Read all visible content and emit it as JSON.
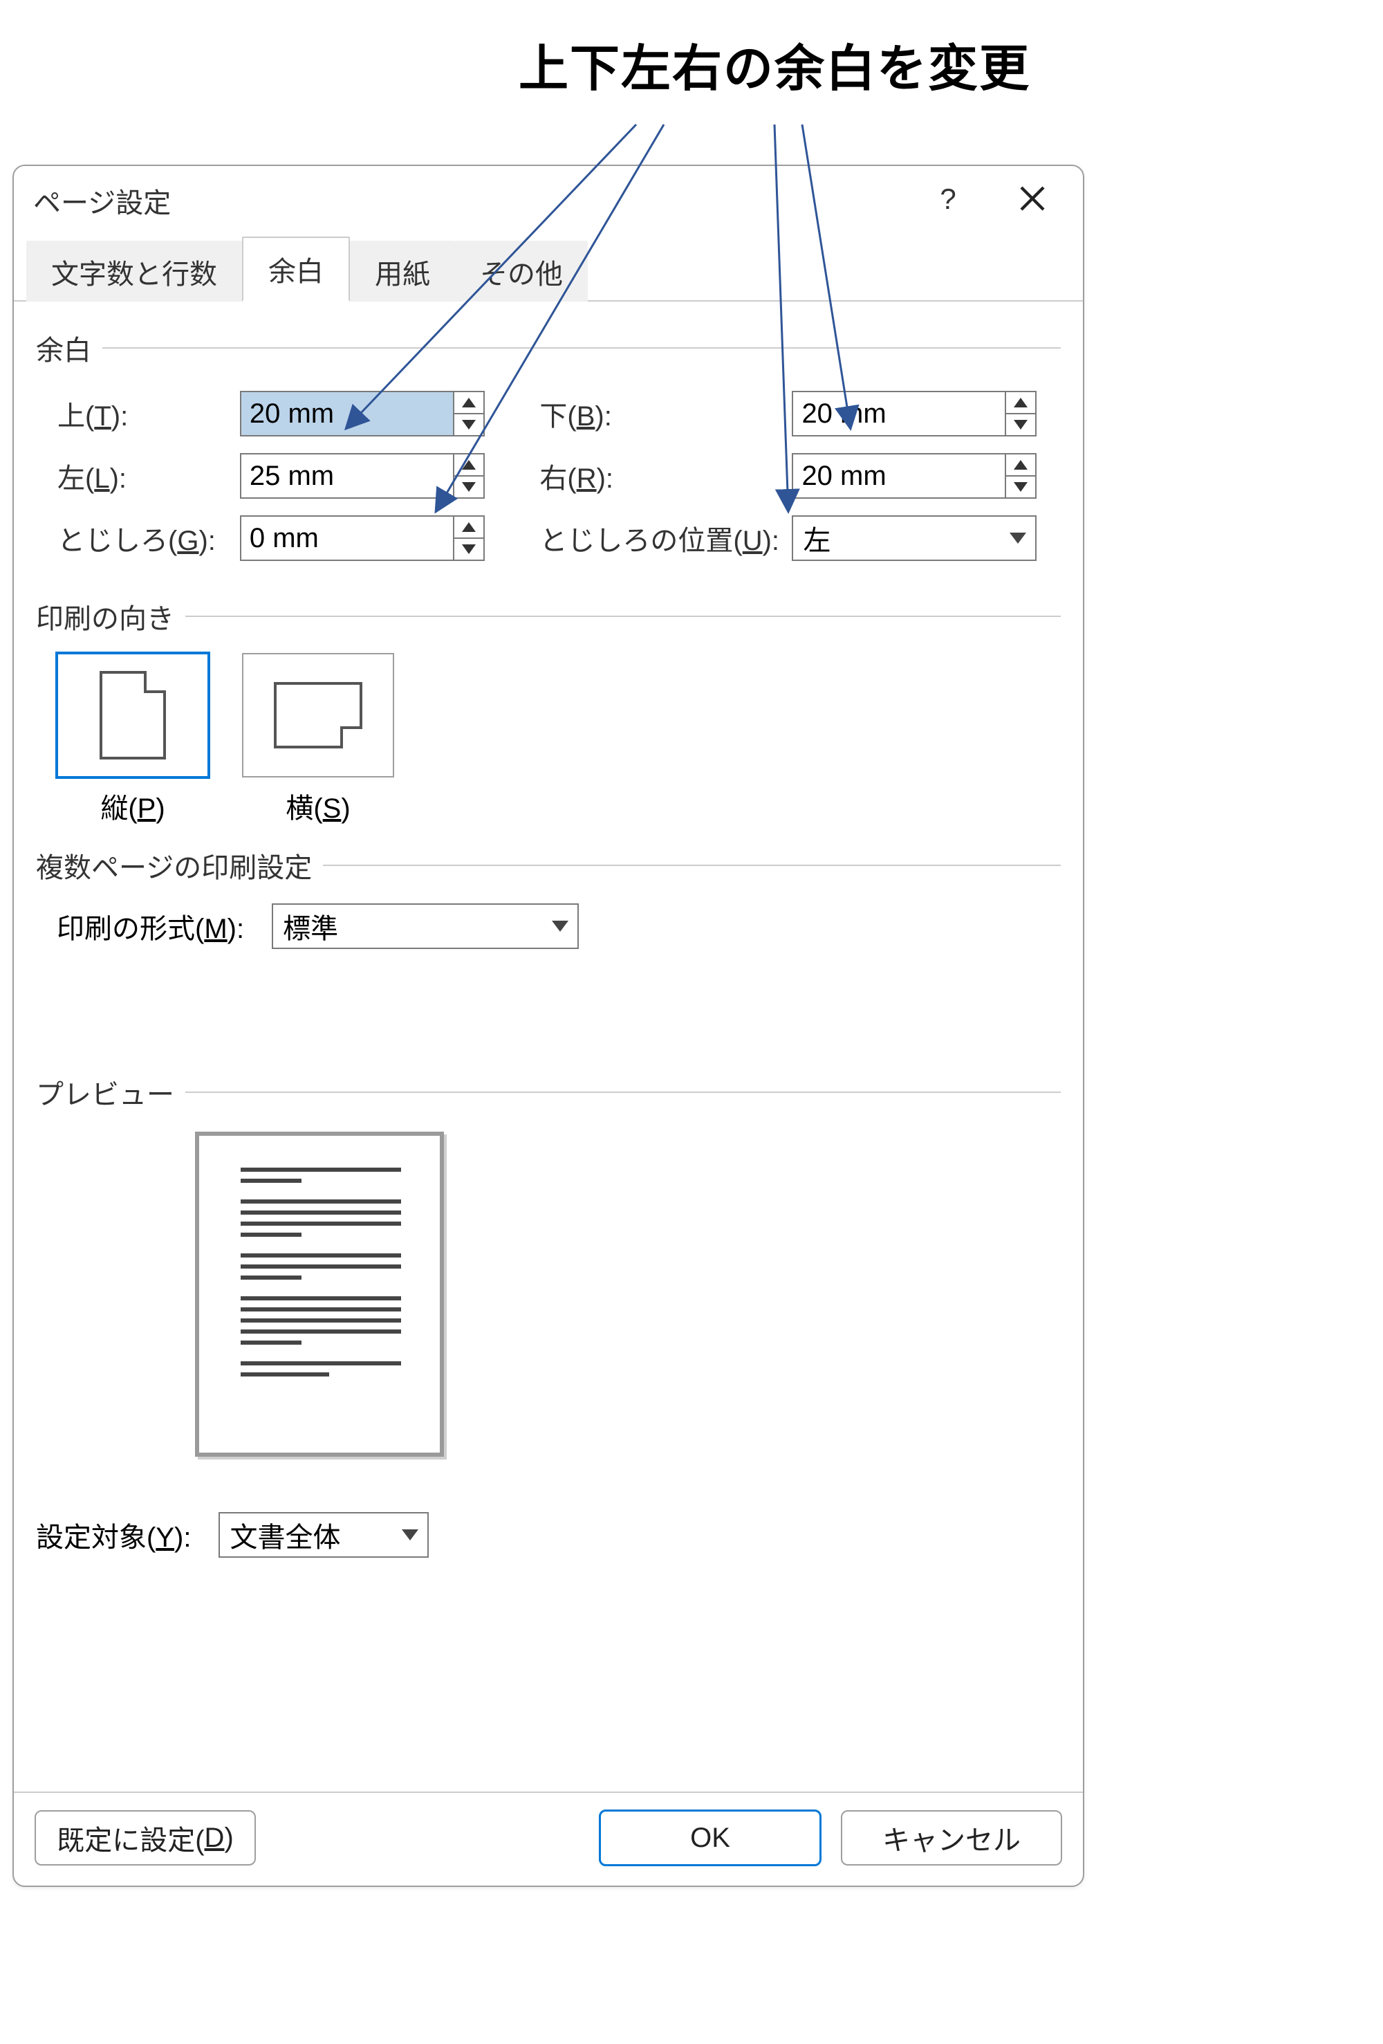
{
  "annotation": {
    "caption": "上下左右の余白を変更"
  },
  "dialog": {
    "title": "ページ設定",
    "help": "?",
    "tabs": [
      "文字数と行数",
      "余白",
      "用紙",
      "その他"
    ],
    "active_tab": "余白"
  },
  "margins": {
    "section_label": "余白",
    "top": {
      "label_prefix": "上(",
      "key": "T",
      "label_suffix": "):",
      "value": "20 mm"
    },
    "bottom": {
      "label_prefix": "下(",
      "key": "B",
      "label_suffix": "):",
      "value": "20 mm"
    },
    "left": {
      "label_prefix": "左(",
      "key": "L",
      "label_suffix": "):",
      "value": "25 mm"
    },
    "right": {
      "label_prefix": "右(",
      "key": "R",
      "label_suffix": "):",
      "value": "20 mm"
    },
    "gutter": {
      "label_prefix": "とじしろ(",
      "key": "G",
      "label_suffix": "):",
      "value": "0 mm"
    },
    "gutter_pos": {
      "label_prefix": "とじしろの位置(",
      "key": "U",
      "label_suffix": "):",
      "value": "左"
    }
  },
  "orientation": {
    "section_label": "印刷の向き",
    "portrait": {
      "label_prefix": "縦(",
      "key": "P",
      "label_suffix": ")"
    },
    "landscape": {
      "label_prefix": "横(",
      "key": "S",
      "label_suffix": ")"
    },
    "selected": "portrait"
  },
  "multipage": {
    "section_label": "複数ページの印刷設定",
    "label_prefix": "印刷の形式(",
    "key": "M",
    "label_suffix": "):",
    "value": "標準"
  },
  "preview": {
    "section_label": "プレビュー"
  },
  "apply_to": {
    "label_prefix": "設定対象(",
    "key": "Y",
    "label_suffix": "):",
    "value": "文書全体"
  },
  "footer": {
    "set_default_prefix": "既定に設定(",
    "set_default_key": "D",
    "set_default_suffix": ")",
    "ok": "OK",
    "cancel": "キャンセル"
  }
}
